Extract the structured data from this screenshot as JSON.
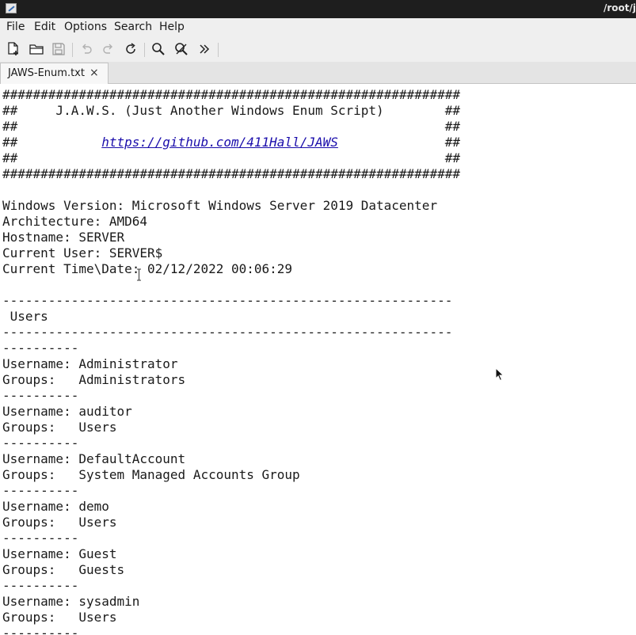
{
  "window": {
    "title": "/root/j"
  },
  "menu": {
    "items": [
      "File",
      "Edit",
      "Options",
      "Search",
      "Help"
    ]
  },
  "toolbar": {
    "buttons": [
      "new-file",
      "open",
      "save",
      "undo",
      "redo",
      "reload",
      "find",
      "find-replace",
      "more"
    ]
  },
  "tabs": [
    {
      "label": "JAWS-Enum.txt",
      "close": "×"
    }
  ],
  "editor": {
    "lines": [
      "############################################################",
      "##     J.A.W.S. (Just Another Windows Enum Script)        ##",
      "##                                                        ##",
      "##           https://github.com/411Hall/JAWS              ##",
      "##                                                        ##",
      "############################################################",
      "",
      "Windows Version: Microsoft Windows Server 2019 Datacenter",
      "Architecture: AMD64",
      "Hostname: SERVER",
      "Current User: SERVER$",
      "Current Time\\Date: 02/12/2022 00:06:29",
      "",
      "-----------------------------------------------------------",
      " Users",
      "-----------------------------------------------------------",
      "----------",
      "Username: Administrator",
      "Groups:   Administrators",
      "----------",
      "Username: auditor",
      "Groups:   Users",
      "----------",
      "Username: DefaultAccount",
      "Groups:   System Managed Accounts Group",
      "----------",
      "Username: demo",
      "Groups:   Users",
      "----------",
      "Username: Guest",
      "Groups:   Guests",
      "----------",
      "Username: sysadmin",
      "Groups:   Users",
      "----------"
    ],
    "link": {
      "prefix": "##           ",
      "url": "https://github.com/411Hall/JAWS",
      "suffix": "              ##"
    }
  },
  "colors": {
    "titlebar": "#1e1e1e",
    "chrome": "#efefef",
    "link": "#1a0dab"
  }
}
